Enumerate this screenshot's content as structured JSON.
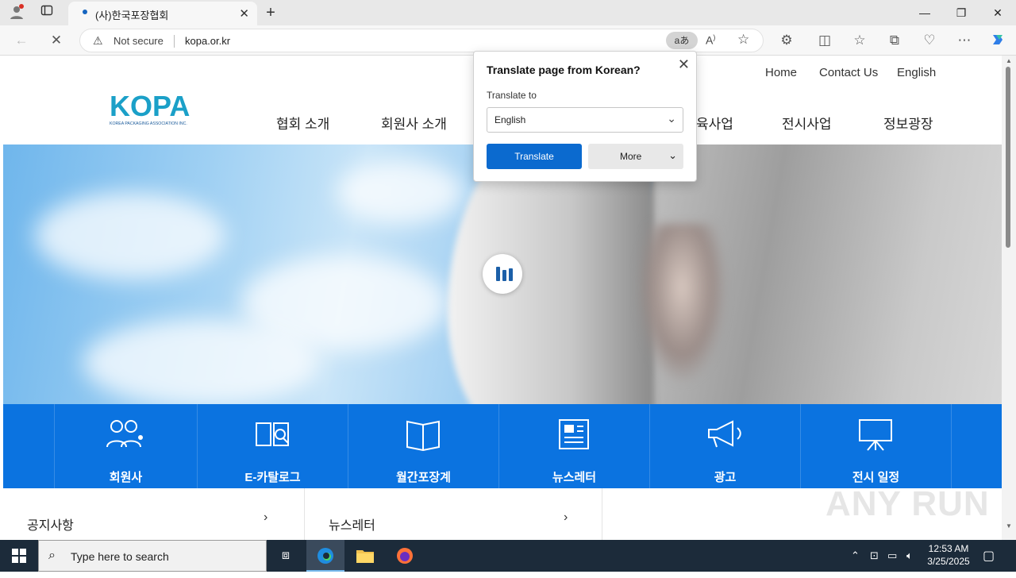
{
  "browser": {
    "tab_title": "(사)한국포장협회",
    "security_label": "Not secure",
    "url": "kopa.or.kr",
    "translate_badge": "aあ"
  },
  "site": {
    "logo_text": "KOPA",
    "logo_subtext": "KOREA PACKAGING ASSOCIATION INC.",
    "top_links": [
      "Home",
      "Contact Us",
      "English"
    ],
    "nav": [
      "협회 소개",
      "회원사 소개",
      "육사업",
      "전시사업",
      "정보광장"
    ],
    "quick_menu": [
      {
        "label": "회원사",
        "icon": "members-icon"
      },
      {
        "label": "E-카탈로그",
        "icon": "catalog-icon"
      },
      {
        "label": "월간포장계",
        "icon": "book-icon"
      },
      {
        "label": "뉴스레터",
        "icon": "newsletter-icon"
      },
      {
        "label": "광고",
        "icon": "megaphone-icon"
      },
      {
        "label": "전시 일정",
        "icon": "easel-icon"
      }
    ],
    "boards": [
      "공지사항",
      "뉴스레터"
    ]
  },
  "translate_popup": {
    "title": "Translate page from Korean?",
    "label": "Translate to",
    "selected_language": "English",
    "translate_button": "Translate",
    "more_button": "More"
  },
  "watermark": "ANY RUN",
  "taskbar": {
    "search_placeholder": "Type here to search",
    "time": "12:53 AM",
    "date": "3/25/2025"
  },
  "colors": {
    "brand_blue": "#0b73e0",
    "logo_teal": "#1ba0c8",
    "button_blue": "#0b6acf"
  }
}
